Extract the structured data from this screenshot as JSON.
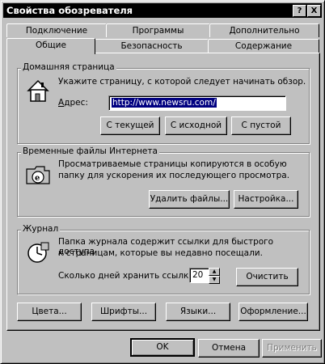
{
  "window": {
    "title": "Свойства обозревателя"
  },
  "titlebar_buttons": {
    "help": "?",
    "close": "X"
  },
  "tabs_back": [
    {
      "label": "Подключение"
    },
    {
      "label": "Программы"
    },
    {
      "label": "Дополнительно"
    }
  ],
  "tabs_front": [
    {
      "label": "Общие"
    },
    {
      "label": "Безопасность"
    },
    {
      "label": "Содержание"
    }
  ],
  "home": {
    "title": "Домашняя страница",
    "description": "Укажите страницу, с которой следует начинать обзор.",
    "address_label": "Адрес:",
    "address_value": "http://www.newsru.com/",
    "btn_current": "С текущей",
    "btn_default": "С исходной",
    "btn_blank": "С пустой"
  },
  "temp": {
    "title": "Временные файлы Интернета",
    "description_line1": "Просматриваемые страницы копируются в особую",
    "description_line2": "папку для ускорения их последующего просмотра.",
    "btn_delete": "Удалить файлы...",
    "btn_settings": "Настройка..."
  },
  "history": {
    "title": "Журнал",
    "description_line1": "Папка журнала содержит ссылки для быстрого доступа",
    "description_line2": "к страницам, которые вы недавно посещали.",
    "days_label": "Сколько дней хранить ссылки:",
    "days_value": "20",
    "btn_clear": "Очистить"
  },
  "bottom_buttons": {
    "colors": "Цвета...",
    "fonts": "Шрифты...",
    "languages": "Языки...",
    "accessibility": "Оформление..."
  },
  "dialog_buttons": {
    "ok": "OK",
    "cancel": "Отмена",
    "apply": "Применить"
  }
}
